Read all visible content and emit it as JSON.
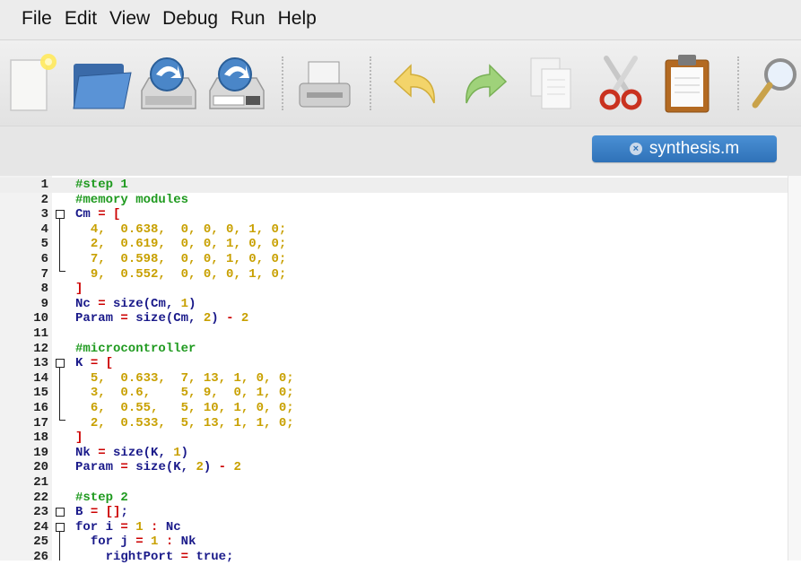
{
  "menu": [
    "File",
    "Edit",
    "View",
    "Debug",
    "Run",
    "Help"
  ],
  "toolbar": {
    "icons": [
      "new-file-icon",
      "open-folder-icon",
      "save-icon",
      "save-as-icon",
      "print-icon",
      "undo-icon",
      "redo-icon",
      "copy-icon",
      "cut-icon",
      "paste-icon",
      "find-icon"
    ]
  },
  "tab": {
    "label": "synthesis.m",
    "close_glyph": "×"
  },
  "editor": {
    "lines": [
      {
        "n": "1",
        "t": [
          [
            "c",
            "#step 1"
          ]
        ]
      },
      {
        "n": "2",
        "t": [
          [
            "c",
            "#memory modules"
          ]
        ]
      },
      {
        "n": "3",
        "t": [
          [
            "p",
            "Cm "
          ],
          [
            "o",
            "= "
          ],
          [
            "b",
            "["
          ]
        ]
      },
      {
        "n": "4",
        "t": [
          [
            "p",
            "  "
          ],
          [
            "d",
            "4,  0.638,  0, 0, 0, 1, 0;"
          ]
        ]
      },
      {
        "n": "5",
        "t": [
          [
            "p",
            "  "
          ],
          [
            "d",
            "2,  0.619,  0, 0, 1, 0, 0;"
          ]
        ]
      },
      {
        "n": "6",
        "t": [
          [
            "p",
            "  "
          ],
          [
            "d",
            "7,  0.598,  0, 0, 1, 0, 0;"
          ]
        ]
      },
      {
        "n": "7",
        "t": [
          [
            "p",
            "  "
          ],
          [
            "d",
            "9,  0.552,  0, 0, 0, 1, 0;"
          ]
        ]
      },
      {
        "n": "8",
        "t": [
          [
            "b",
            "]"
          ]
        ]
      },
      {
        "n": "9",
        "t": [
          [
            "p",
            "Nc "
          ],
          [
            "o",
            "= "
          ],
          [
            "p",
            "size(Cm, "
          ],
          [
            "d",
            "1"
          ],
          [
            "p",
            ")"
          ]
        ]
      },
      {
        "n": "10",
        "t": [
          [
            "p",
            "Param "
          ],
          [
            "o",
            "= "
          ],
          [
            "p",
            "size(Cm, "
          ],
          [
            "d",
            "2"
          ],
          [
            "p",
            ") "
          ],
          [
            "o",
            "- "
          ],
          [
            "d",
            "2"
          ]
        ]
      },
      {
        "n": "11",
        "t": []
      },
      {
        "n": "12",
        "t": [
          [
            "c",
            "#microcontroller"
          ]
        ]
      },
      {
        "n": "13",
        "t": [
          [
            "p",
            "K "
          ],
          [
            "o",
            "= "
          ],
          [
            "b",
            "["
          ]
        ]
      },
      {
        "n": "14",
        "t": [
          [
            "p",
            "  "
          ],
          [
            "d",
            "5,  0.633,  7, 13, 1, 0, 0;"
          ]
        ]
      },
      {
        "n": "15",
        "t": [
          [
            "p",
            "  "
          ],
          [
            "d",
            "3,  0.6,    5, 9,  0, 1, 0;"
          ]
        ]
      },
      {
        "n": "16",
        "t": [
          [
            "p",
            "  "
          ],
          [
            "d",
            "6,  0.55,   5, 10, 1, 0, 0;"
          ]
        ]
      },
      {
        "n": "17",
        "t": [
          [
            "p",
            "  "
          ],
          [
            "d",
            "2,  0.533,  5, 13, 1, 1, 0;"
          ]
        ]
      },
      {
        "n": "18",
        "t": [
          [
            "b",
            "]"
          ]
        ]
      },
      {
        "n": "19",
        "t": [
          [
            "p",
            "Nk "
          ],
          [
            "o",
            "= "
          ],
          [
            "p",
            "size(K, "
          ],
          [
            "d",
            "1"
          ],
          [
            "p",
            ")"
          ]
        ]
      },
      {
        "n": "20",
        "t": [
          [
            "p",
            "Param "
          ],
          [
            "o",
            "= "
          ],
          [
            "p",
            "size(K, "
          ],
          [
            "d",
            "2"
          ],
          [
            "p",
            ") "
          ],
          [
            "o",
            "- "
          ],
          [
            "d",
            "2"
          ]
        ]
      },
      {
        "n": "21",
        "t": []
      },
      {
        "n": "22",
        "t": [
          [
            "c",
            "#step 2"
          ]
        ]
      },
      {
        "n": "23",
        "t": [
          [
            "p",
            "B "
          ],
          [
            "o",
            "= "
          ],
          [
            "b",
            "[]"
          ],
          [
            "p",
            ";"
          ]
        ]
      },
      {
        "n": "24",
        "t": [
          [
            "k",
            "for "
          ],
          [
            "p",
            "i "
          ],
          [
            "o",
            "= "
          ],
          [
            "d",
            "1 "
          ],
          [
            "o",
            ": "
          ],
          [
            "p",
            "Nc"
          ]
        ]
      },
      {
        "n": "25",
        "t": [
          [
            "p",
            "  "
          ],
          [
            "k",
            "for "
          ],
          [
            "p",
            "j "
          ],
          [
            "o",
            "= "
          ],
          [
            "d",
            "1 "
          ],
          [
            "o",
            ": "
          ],
          [
            "p",
            "Nk"
          ]
        ]
      },
      {
        "n": "26",
        "t": [
          [
            "p",
            "    rightPort "
          ],
          [
            "o",
            "= "
          ],
          [
            "p",
            "true;"
          ]
        ]
      }
    ]
  },
  "colors": {
    "comment": "#1f9a1f",
    "number": "#c8a000",
    "bracket": "#cc0000",
    "plain": "#1a1a8a",
    "tab_accent": "#3a80c6"
  }
}
